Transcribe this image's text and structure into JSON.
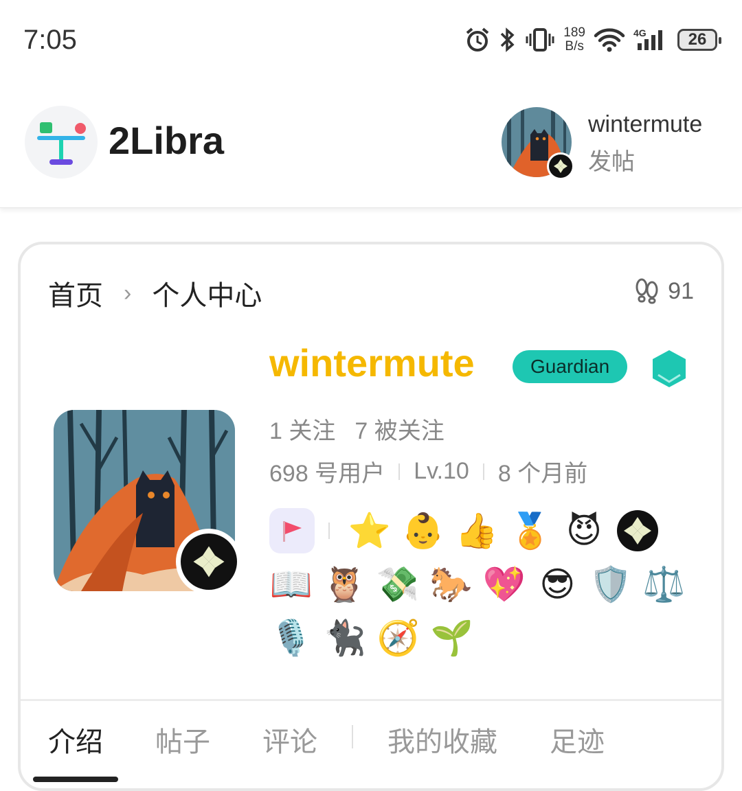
{
  "status_bar": {
    "time": "7:05",
    "net_speed_value": "189",
    "net_speed_unit": "B/s",
    "network": "4G",
    "battery": "26"
  },
  "header": {
    "brand": "2Libra",
    "username": "wintermute",
    "post_label": "发帖"
  },
  "breadcrumb": {
    "home": "首页",
    "current": "个人中心",
    "separator": "›",
    "view_count": "91"
  },
  "profile": {
    "name": "wintermute",
    "role": "Guardian",
    "following": "1 关注",
    "followers": "7 被关注",
    "user_number": "698 号用户",
    "level": "Lv.10",
    "joined": "8 个月前",
    "name_color": "#f5b800",
    "role_color": "#1ec7b2"
  },
  "badges": {
    "row1": [
      "⭐",
      "👶",
      "👍",
      "🏅",
      "😈"
    ],
    "row2": [
      "📖",
      "🦉",
      "💸",
      "🐎",
      "💖",
      "😎",
      "🛡️",
      "⚖️"
    ],
    "row3": [
      "🎙️",
      "🐈‍⬛",
      "🧭",
      "🌱"
    ]
  },
  "tabs": [
    "介绍",
    "帖子",
    "评论",
    "我的收藏",
    "足迹"
  ]
}
